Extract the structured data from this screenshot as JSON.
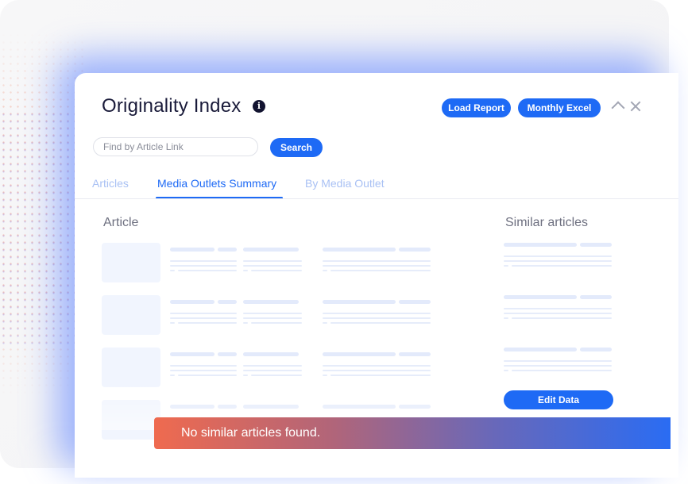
{
  "dialog": {
    "title": "Originality Index",
    "info_icon": "info-icon",
    "load_report_label": "Load Report",
    "monthly_excel_label": "Monthly Excel",
    "collapse_icon": "chevron-up-icon",
    "close_icon": "close-icon"
  },
  "search": {
    "placeholder": "Find by Article Link",
    "value": "",
    "button_label": "Search"
  },
  "tabs": [
    {
      "label": "Articles",
      "active": false
    },
    {
      "label": "Media Outlets Summary",
      "active": true
    },
    {
      "label": "By Media Outlet",
      "active": false
    }
  ],
  "table": {
    "article_header": "Article",
    "similar_header": "Similar articles",
    "edit_label": "Edit Data"
  },
  "toast": {
    "message": "No similar articles found."
  },
  "colors": {
    "accent": "#1e6af5",
    "title": "#1a1b3a",
    "inactive_tab": "#a9c1f4",
    "skeleton": "#e3eafb",
    "toast_gradient_start": "#ef6a4f",
    "toast_gradient_end": "#2a6cf3"
  }
}
